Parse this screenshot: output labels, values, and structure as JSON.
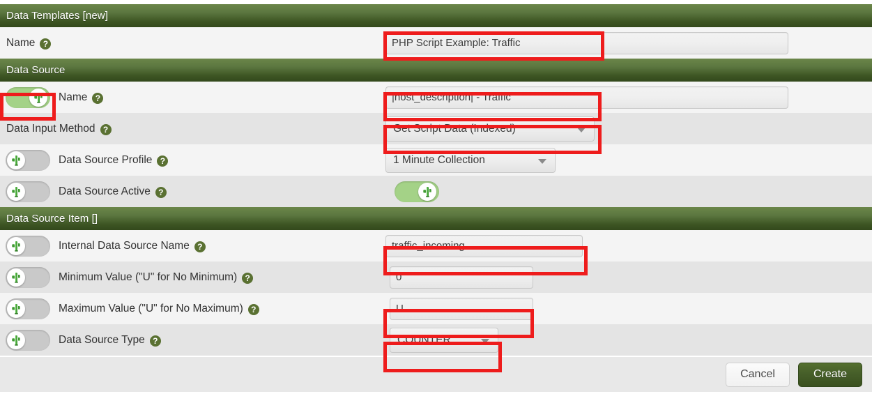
{
  "window": {
    "title": "Data Templates [new]"
  },
  "template": {
    "name_label": "Name",
    "name_value": "PHP Script Example: Traffic",
    "name_placeholder": ""
  },
  "sections": {
    "data_source": "Data Source",
    "data_source_item": "Data Source Item []"
  },
  "data_source": {
    "name": {
      "label": "Name",
      "value": "|host_description| - Traffic",
      "toggle": "on"
    },
    "input_method": {
      "label": "Data Input Method",
      "value": "Get Script Data (Indexed)",
      "toggle": "none"
    },
    "profile": {
      "label": "Data Source Profile",
      "value": "1 Minute Collection",
      "toggle": "off"
    },
    "active": {
      "label": "Data Source Active",
      "value": "on",
      "toggle": "off"
    }
  },
  "data_source_item": {
    "internal_name": {
      "label": "Internal Data Source Name",
      "value": "traffic_incoming",
      "toggle": "off"
    },
    "minimum": {
      "label": "Minimum Value (\"U\" for No Minimum)",
      "value": "0",
      "toggle": "off"
    },
    "maximum": {
      "label": "Maximum Value (\"U\" for No Maximum)",
      "value": "U",
      "toggle": "off"
    },
    "ds_type": {
      "label": "Data Source Type",
      "value": "COUNTER",
      "toggle": "off"
    }
  },
  "footer": {
    "cancel_label": "Cancel",
    "create_label": "Create"
  },
  "icons": {
    "help": "?"
  },
  "colors": {
    "header_green_top": "#6b8649",
    "header_green_bottom": "#33491c",
    "toggle_on": "#a4d287",
    "toggle_off": "#c9c9c9",
    "highlight_red": "#ee1c1c",
    "row_light": "#f4f4f4",
    "row_dark": "#e4e4e4",
    "create_button": "#47602a"
  }
}
